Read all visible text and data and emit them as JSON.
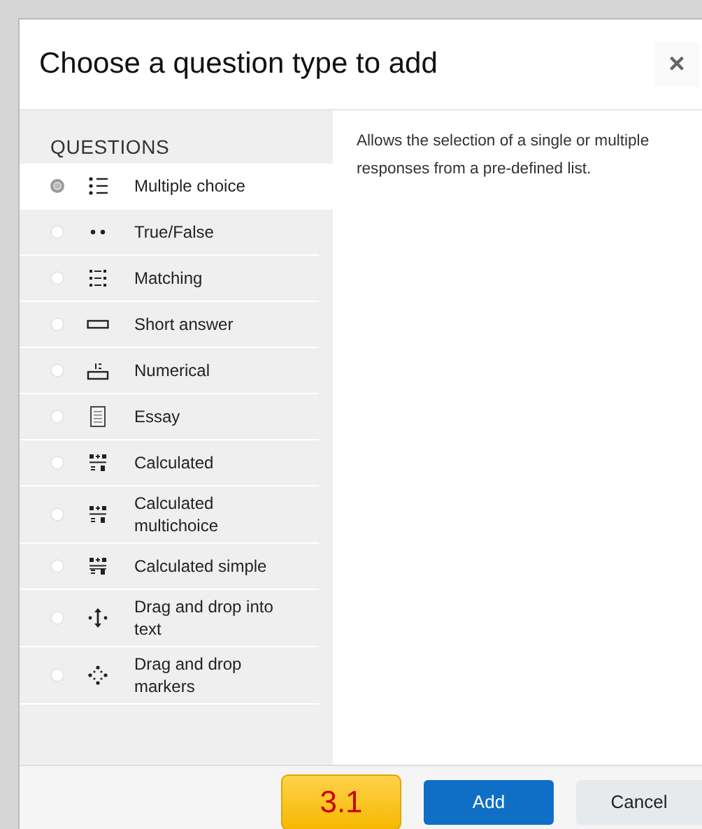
{
  "dialog": {
    "title": "Choose a question type to add",
    "close": "×"
  },
  "sidebar": {
    "heading": "QUESTIONS",
    "items": [
      {
        "label": "Multiple choice",
        "kind": "multichoice",
        "selected": true
      },
      {
        "label": "True/False",
        "kind": "truefalse",
        "selected": false
      },
      {
        "label": "Matching",
        "kind": "match",
        "selected": false
      },
      {
        "label": "Short answer",
        "kind": "shortanswer",
        "selected": false
      },
      {
        "label": "Numerical",
        "kind": "numerical",
        "selected": false
      },
      {
        "label": "Essay",
        "kind": "essay",
        "selected": false
      },
      {
        "label": "Calculated",
        "kind": "calculated",
        "selected": false
      },
      {
        "label": "Calculated multichoice",
        "kind": "calculated",
        "selected": false
      },
      {
        "label": "Calculated simple",
        "kind": "calculatedsimple",
        "selected": false
      },
      {
        "label": "Drag and drop into text",
        "kind": "ddtext",
        "selected": false
      },
      {
        "label": "Drag and drop markers",
        "kind": "ddmarker",
        "selected": false
      }
    ]
  },
  "description": "Allows the selection of a single or multiple responses from a pre-defined list.",
  "footer": {
    "badge": "3.1",
    "buttons": [
      {
        "label": "Add",
        "kind": "primary"
      },
      {
        "label": "Cancel",
        "kind": "secondary"
      }
    ]
  }
}
